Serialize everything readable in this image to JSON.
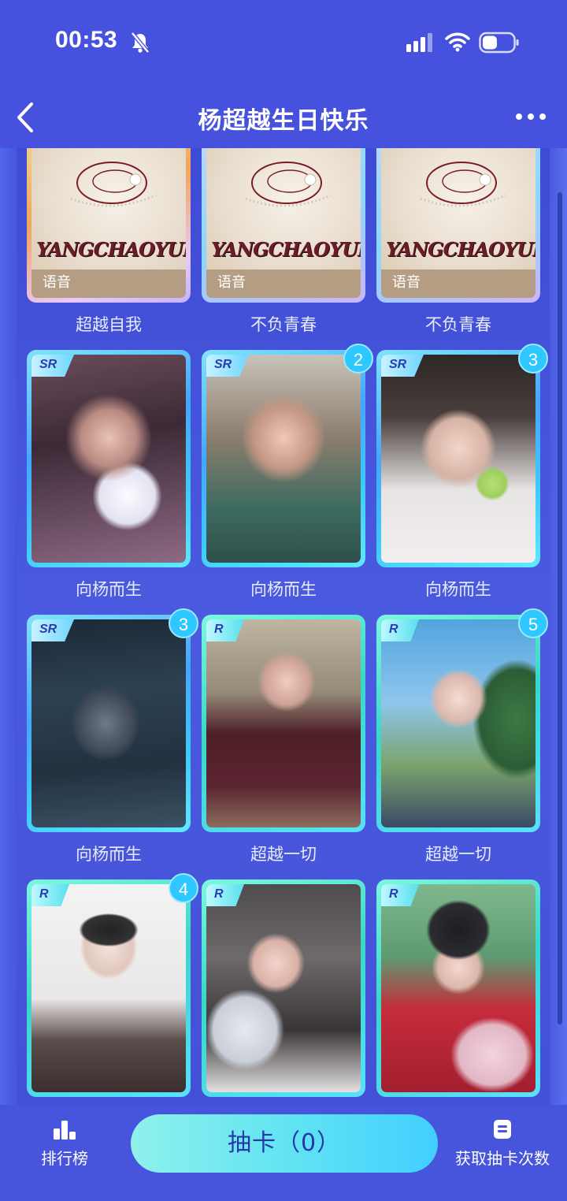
{
  "status_bar": {
    "time": "00:53"
  },
  "nav": {
    "title": "杨超越生日快乐"
  },
  "voice_cards": [
    {
      "tag": "语音",
      "logo": "YANGCHAOYUE",
      "label": "超越自我"
    },
    {
      "tag": "语音",
      "logo": "YANGCHAOYUE",
      "label": "不负青春"
    },
    {
      "tag": "语音",
      "logo": "YANGCHAOYUE",
      "label": "不负青春"
    }
  ],
  "photo_cards": [
    {
      "rarity": "SR",
      "count": "",
      "label": "向杨而生"
    },
    {
      "rarity": "SR",
      "count": "2",
      "label": "向杨而生"
    },
    {
      "rarity": "SR",
      "count": "3",
      "label": "向杨而生"
    },
    {
      "rarity": "SR",
      "count": "3",
      "label": "向杨而生"
    },
    {
      "rarity": "R",
      "count": "",
      "label": "超越一切"
    },
    {
      "rarity": "R",
      "count": "5",
      "label": "超越一切"
    },
    {
      "rarity": "R",
      "count": "4",
      "label": ""
    },
    {
      "rarity": "R",
      "count": "",
      "label": ""
    },
    {
      "rarity": "R",
      "count": "",
      "label": ""
    }
  ],
  "bottom_bar": {
    "rank_label": "排行榜",
    "draw_label": "抽卡（0）",
    "get_label": "获取抽卡次数"
  }
}
